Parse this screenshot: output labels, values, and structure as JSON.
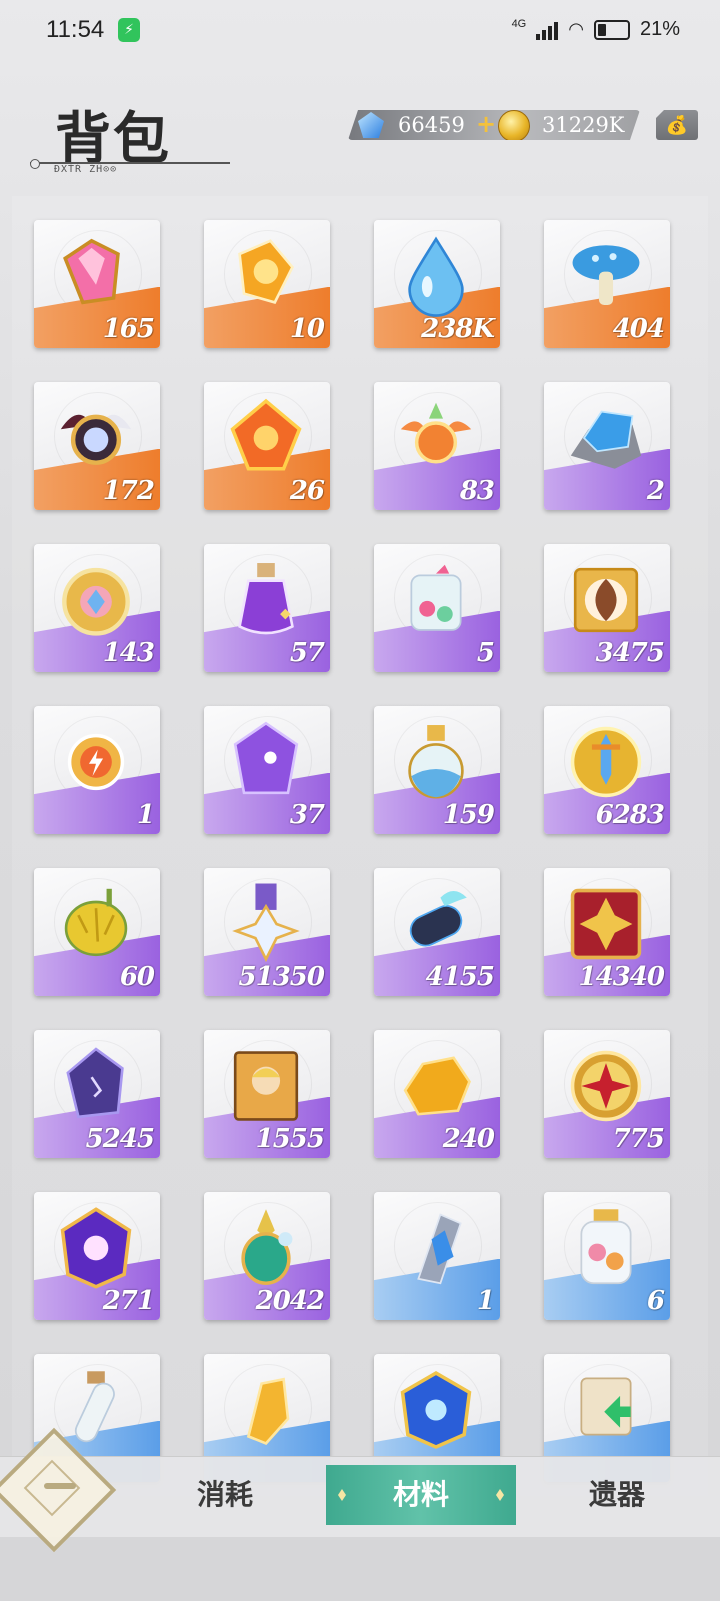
{
  "status_bar": {
    "time": "11:54",
    "battery": "21%",
    "network": "4G"
  },
  "header": {
    "title": "背包",
    "subtitle": "ÐXŤŔ ŹĤ⊙⊙"
  },
  "currency": {
    "gems": "66459",
    "plus": "+",
    "coins": "31229K"
  },
  "colors": {
    "orange": "#ee7d2c",
    "purple": "#9a62e0",
    "blue": "#5b9ee8",
    "tab_active": "#4fb49b"
  },
  "items": [
    {
      "icon": "pink-crystal-icon",
      "count": "165",
      "quality": "orange"
    },
    {
      "icon": "gold-gem-icon",
      "count": "10",
      "quality": "orange"
    },
    {
      "icon": "water-drop-icon",
      "count": "238K",
      "quality": "orange"
    },
    {
      "icon": "blue-mushroom-icon",
      "count": "404",
      "quality": "orange"
    },
    {
      "icon": "dark-wing-orb-icon",
      "count": "172",
      "quality": "orange"
    },
    {
      "icon": "fire-core-icon",
      "count": "26",
      "quality": "orange"
    },
    {
      "icon": "phoenix-emblem-icon",
      "count": "83",
      "quality": "purple"
    },
    {
      "icon": "blue-ore-icon",
      "count": "2",
      "quality": "purple"
    },
    {
      "icon": "gold-medal-icon",
      "count": "143",
      "quality": "purple"
    },
    {
      "icon": "purple-potion-icon",
      "count": "57",
      "quality": "purple"
    },
    {
      "icon": "candy-jar-icon",
      "count": "5",
      "quality": "purple"
    },
    {
      "icon": "swirl-cookie-icon",
      "count": "3475",
      "quality": "purple"
    },
    {
      "icon": "lightning-badge-icon",
      "count": "1",
      "quality": "purple"
    },
    {
      "icon": "purple-crystal-icon",
      "count": "37",
      "quality": "purple"
    },
    {
      "icon": "sand-flask-icon",
      "count": "159",
      "quality": "purple"
    },
    {
      "icon": "sword-coin-icon",
      "count": "6283",
      "quality": "purple"
    },
    {
      "icon": "durian-icon",
      "count": "60",
      "quality": "purple"
    },
    {
      "icon": "star-medal-icon",
      "count": "51350",
      "quality": "purple"
    },
    {
      "icon": "log-icon",
      "count": "4155",
      "quality": "purple"
    },
    {
      "icon": "fleur-box-icon",
      "count": "14340",
      "quality": "purple"
    },
    {
      "icon": "void-crystal-icon",
      "count": "5245",
      "quality": "purple"
    },
    {
      "icon": "portrait-ticket-icon",
      "count": "1555",
      "quality": "purple"
    },
    {
      "icon": "gold-nugget-icon",
      "count": "240",
      "quality": "purple"
    },
    {
      "icon": "star-coin-icon",
      "count": "775",
      "quality": "purple"
    },
    {
      "icon": "void-sphere-icon",
      "count": "271",
      "quality": "purple"
    },
    {
      "icon": "emerald-spire-icon",
      "count": "2042",
      "quality": "purple"
    },
    {
      "icon": "ice-shard-icon",
      "count": "1",
      "quality": "blue"
    },
    {
      "icon": "bead-jar-icon",
      "count": "6",
      "quality": "blue"
    },
    {
      "icon": "test-tube-icon",
      "count": "",
      "quality": "blue"
    },
    {
      "icon": "amber-shard-icon",
      "count": "",
      "quality": "blue"
    },
    {
      "icon": "blue-cube-icon",
      "count": "",
      "quality": "blue"
    },
    {
      "icon": "scroll-icon",
      "count": "",
      "quality": "blue"
    }
  ],
  "tabs": [
    {
      "label": "消耗",
      "active": false
    },
    {
      "label": "材料",
      "active": true
    },
    {
      "label": "遗器",
      "active": false
    }
  ]
}
